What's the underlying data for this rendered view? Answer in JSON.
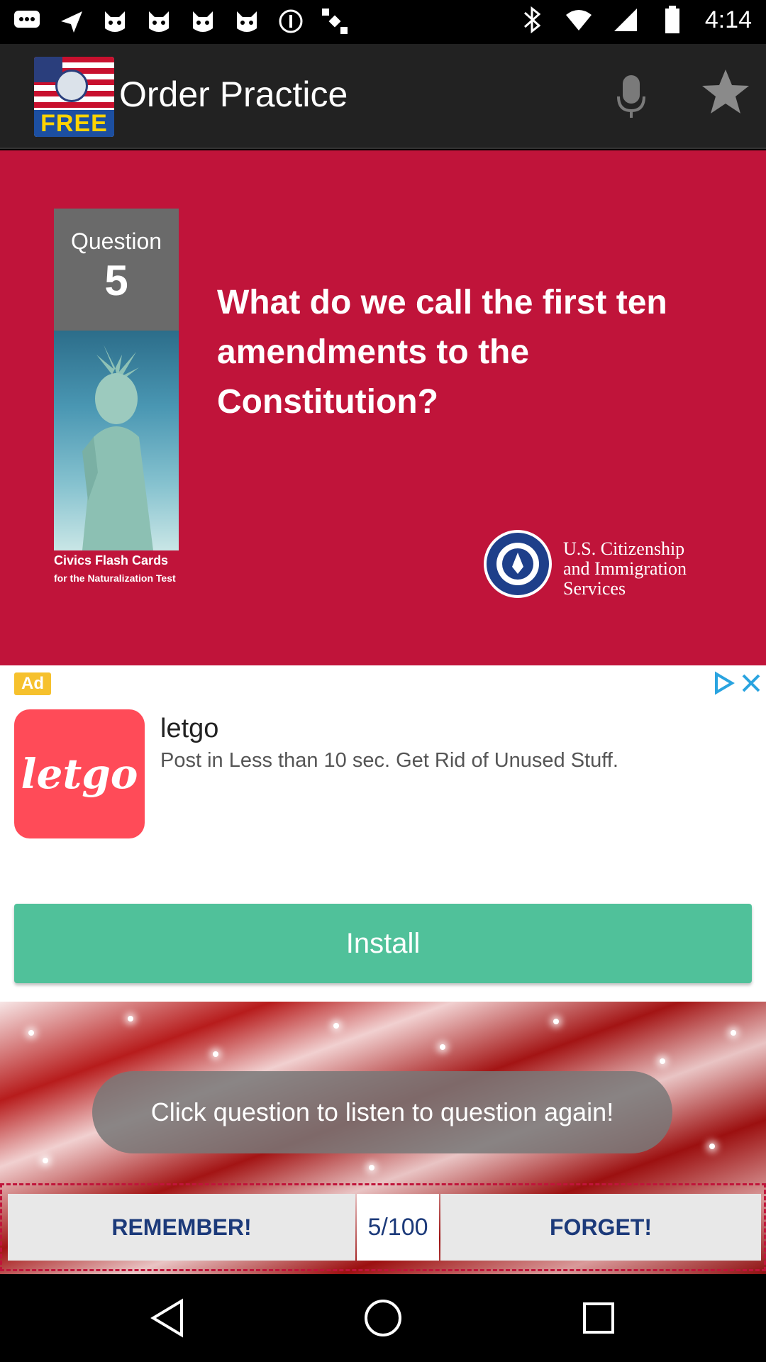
{
  "status_bar": {
    "time": "4:14",
    "icons": [
      "message-icon",
      "send-icon",
      "cat-icon",
      "cat-icon",
      "cat-icon",
      "cat-icon",
      "info-icon",
      "satellite-icon",
      "bluetooth-icon",
      "wifi-icon",
      "signal-icon",
      "battery-icon"
    ]
  },
  "app_bar": {
    "logo_text": "FREE",
    "title": "Order Practice",
    "mic_icon": "microphone-icon",
    "star_icon": "star-icon"
  },
  "question": {
    "label": "Question",
    "number": "5",
    "text": "What do we call the first ten amendments to the Constitution?",
    "caption_line1": "Civics Flash Cards",
    "caption_line2": "for the Naturalization Test",
    "agency_line1": "U.S. Citizenship",
    "agency_line2": "and Immigration",
    "agency_line3": "Services",
    "background_color": "#c0143a"
  },
  "ad": {
    "badge": "Ad",
    "logo_text": "letgo",
    "brand": "letgo",
    "description": "Post in Less than 10 sec. Get Rid of Unused Stuff.",
    "install_label": "Install",
    "install_color": "#50c19a"
  },
  "footer": {
    "hint": "Click question to listen to question again!",
    "remember_label": "REMEMBER!",
    "counter": "5/100",
    "forget_label": "FORGET!"
  },
  "nav": {
    "back_icon": "back-triangle-icon",
    "home_icon": "home-circle-icon",
    "recents_icon": "recents-square-icon"
  }
}
